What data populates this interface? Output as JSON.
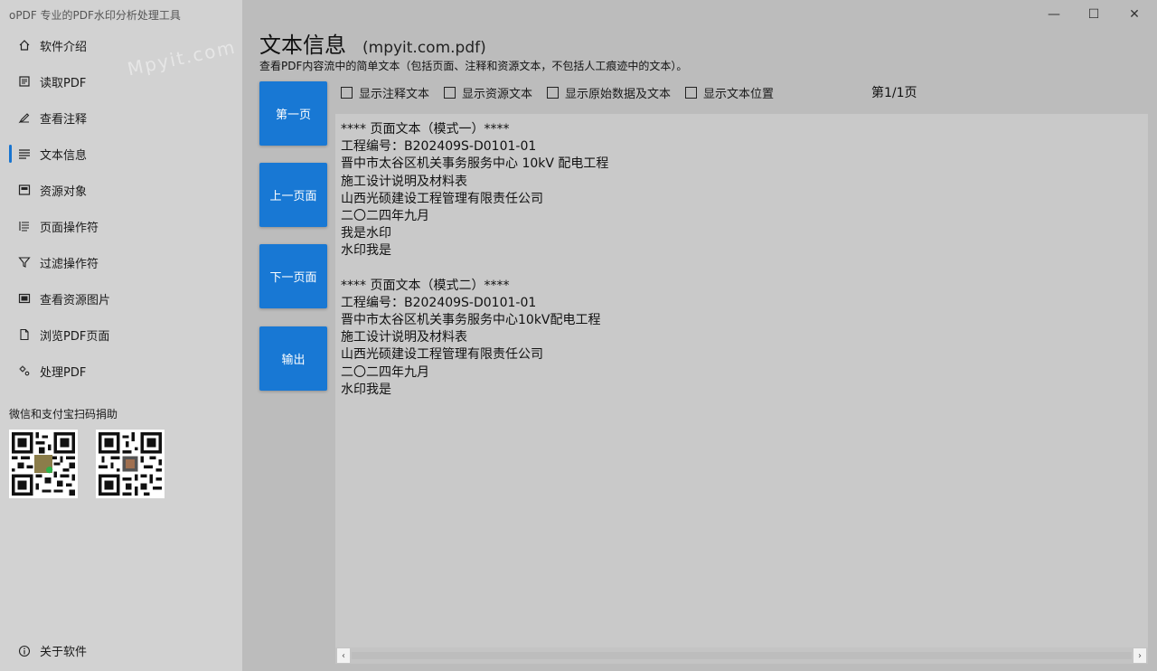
{
  "app": {
    "title": "oPDF 专业的PDF水印分析处理工具"
  },
  "window": {
    "minimize": "—",
    "maximize": "☐",
    "close": "✕"
  },
  "sidebar": {
    "items": [
      {
        "label": "软件介绍",
        "icon": "home-icon"
      },
      {
        "label": "读取PDF",
        "icon": "document-icon"
      },
      {
        "label": "查看注释",
        "icon": "edit-icon"
      },
      {
        "label": "文本信息",
        "icon": "text-lines-icon",
        "active": true
      },
      {
        "label": "资源对象",
        "icon": "frame-icon"
      },
      {
        "label": "页面操作符",
        "icon": "list-icon"
      },
      {
        "label": "过滤操作符",
        "icon": "filter-icon"
      },
      {
        "label": "查看资源图片",
        "icon": "image-icon"
      },
      {
        "label": "浏览PDF页面",
        "icon": "page-icon"
      },
      {
        "label": "处理PDF",
        "icon": "settings-icon"
      }
    ],
    "donate_label": "微信和支付宝扫码捐助",
    "about_label": "关于软件"
  },
  "main": {
    "title": "文本信息",
    "file": "(mpyit.com.pdf)",
    "description": "查看PDF内容流中的简单文本（包括页面、注释和资源文本，不包括人工痕迹中的文本）。",
    "buttons": {
      "first": "第一页",
      "prev": "上一页面",
      "next": "下一页面",
      "export": "输出"
    },
    "options": [
      "显示注释文本",
      "显示资源文本",
      "显示原始数据及文本",
      "显示文本位置"
    ],
    "page_indicator": "第1/1页",
    "text_lines": [
      "**** 页面文本（模式一）****",
      "工程编号：B202409S-D0101-01",
      "晋中市太谷区机关事务服务中心 10kV 配电工程",
      "施工设计说明及材料表",
      "山西光硕建设工程管理有限责任公司",
      "二〇二四年九月",
      "我是水印",
      "水印我是",
      "",
      "**** 页面文本（模式二）****",
      "工程编号：B202409S-D0101-01",
      "晋中市太谷区机关事务服务中心10kV配电工程",
      "施工设计说明及材料表",
      "山西光硕建设工程管理有限责任公司",
      "二〇二四年九月",
      "水印我是"
    ]
  },
  "watermark": "Mpyit.com",
  "colors": {
    "accent": "#1878d4",
    "sidebar_bg": "#d2d2d2",
    "main_bg": "#bcbcbc"
  }
}
